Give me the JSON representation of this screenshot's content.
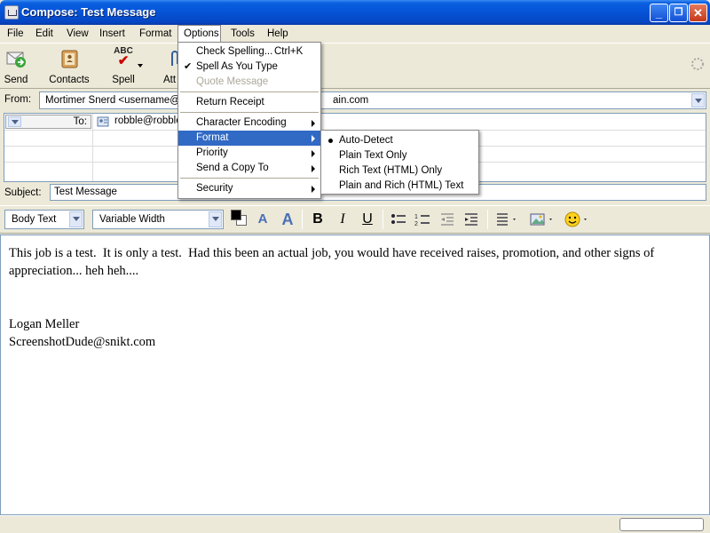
{
  "window": {
    "title": "Compose: Test Message",
    "minimize": "_",
    "maximize": "❐",
    "close": "✕"
  },
  "menubar": [
    "File",
    "Edit",
    "View",
    "Insert",
    "Format",
    "Options",
    "Tools",
    "Help"
  ],
  "toolbar": {
    "send": "Send",
    "contacts": "Contacts",
    "spell": "Spell",
    "spell_icon_text": "ABC",
    "attach": "Att"
  },
  "address": {
    "from_label": "From:",
    "from_value": "Mortimer Snerd <username@d",
    "from_value_tail": "ain.com",
    "to_label": "To:",
    "to_value": "robble@robble",
    "subject_label": "Subject:",
    "subject_value": "Test Message"
  },
  "format_bar": {
    "paragraph_style": "Body Text",
    "font": "Variable Width",
    "bold": "B",
    "italic": "I",
    "underline": "U"
  },
  "body": {
    "paragraph1": "This job is a test.  It is only a test.  Had this been an actual job, you would have received raises, promotion, and other signs of appreciation... heh heh....",
    "signature_name": "Logan Meller",
    "signature_email": "ScreenshotDude@snikt.com"
  },
  "options_menu": {
    "check_spelling": "Check Spelling...",
    "check_spelling_shortcut": "Ctrl+K",
    "spell_as_you_type": "Spell As You Type",
    "quote_message": "Quote Message",
    "return_receipt": "Return Receipt",
    "character_encoding": "Character Encoding",
    "format": "Format",
    "priority": "Priority",
    "send_copy_to": "Send a Copy To",
    "security": "Security"
  },
  "format_submenu": {
    "auto_detect": "Auto-Detect",
    "plain_text_only": "Plain Text Only",
    "rich_text_only": "Rich Text (HTML) Only",
    "plain_and_rich": "Plain and Rich (HTML) Text",
    "selected": "Auto-Detect"
  },
  "colors": {
    "title_bar": "#0553d6",
    "highlight": "#316ac5",
    "chrome": "#ece9d8"
  }
}
